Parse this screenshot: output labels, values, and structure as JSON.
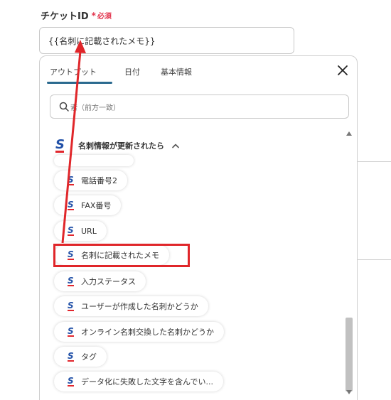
{
  "field": {
    "label": "チケットID",
    "required_star": "*",
    "required_text": "必須",
    "value": "{{名刺に記載されたメモ}}"
  },
  "panel": {
    "tabs": [
      {
        "label": "アウトプット",
        "active": true
      },
      {
        "label": "日付",
        "active": false
      },
      {
        "label": "基本情報",
        "active": false
      }
    ],
    "search_placeholder": "検索（前方一致）",
    "search_visible_text": "索（前方一致）",
    "group_title": "名刺情報が更新されたら",
    "items": [
      "",
      "電話番号2",
      "FAX番号",
      "URL",
      "名刺に記載されたメモ",
      "入力ステータス",
      "ユーザーが作成した名刺かどうか",
      "オンライン名刺交換した名刺かどうか",
      "タグ",
      "データ化に失敗した文字を含んでい..."
    ]
  },
  "colors": {
    "accent": "#2b6a8f",
    "required": "#e2334c",
    "highlight": "#e0262a",
    "logo_blue": "#2251a8",
    "logo_red": "#e1262d"
  },
  "icons": {
    "close": "close-icon",
    "search": "search-icon",
    "chevron": "chevron-up-icon",
    "app_logo": "sansan-logo-icon"
  }
}
